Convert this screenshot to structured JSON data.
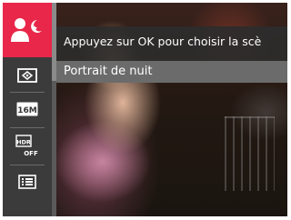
{
  "menu": {
    "hint": "Appuyez sur OK pour choisir la scè",
    "selected_option": "Portrait de nuit"
  },
  "sidebar": {
    "items": [
      {
        "icon": "night-portrait-icon",
        "selected": true
      },
      {
        "icon": "metering-icon",
        "selected": false
      },
      {
        "icon": "image-size-icon",
        "label": "16M",
        "selected": false
      },
      {
        "icon": "hdr-off-icon",
        "label": "HDR OFF",
        "selected": false
      },
      {
        "icon": "menu-list-icon",
        "selected": false
      }
    ]
  },
  "colors": {
    "accent": "#e8274a",
    "sidebar": "#3b3b3b",
    "highlight_row": "#6b6b6b"
  }
}
